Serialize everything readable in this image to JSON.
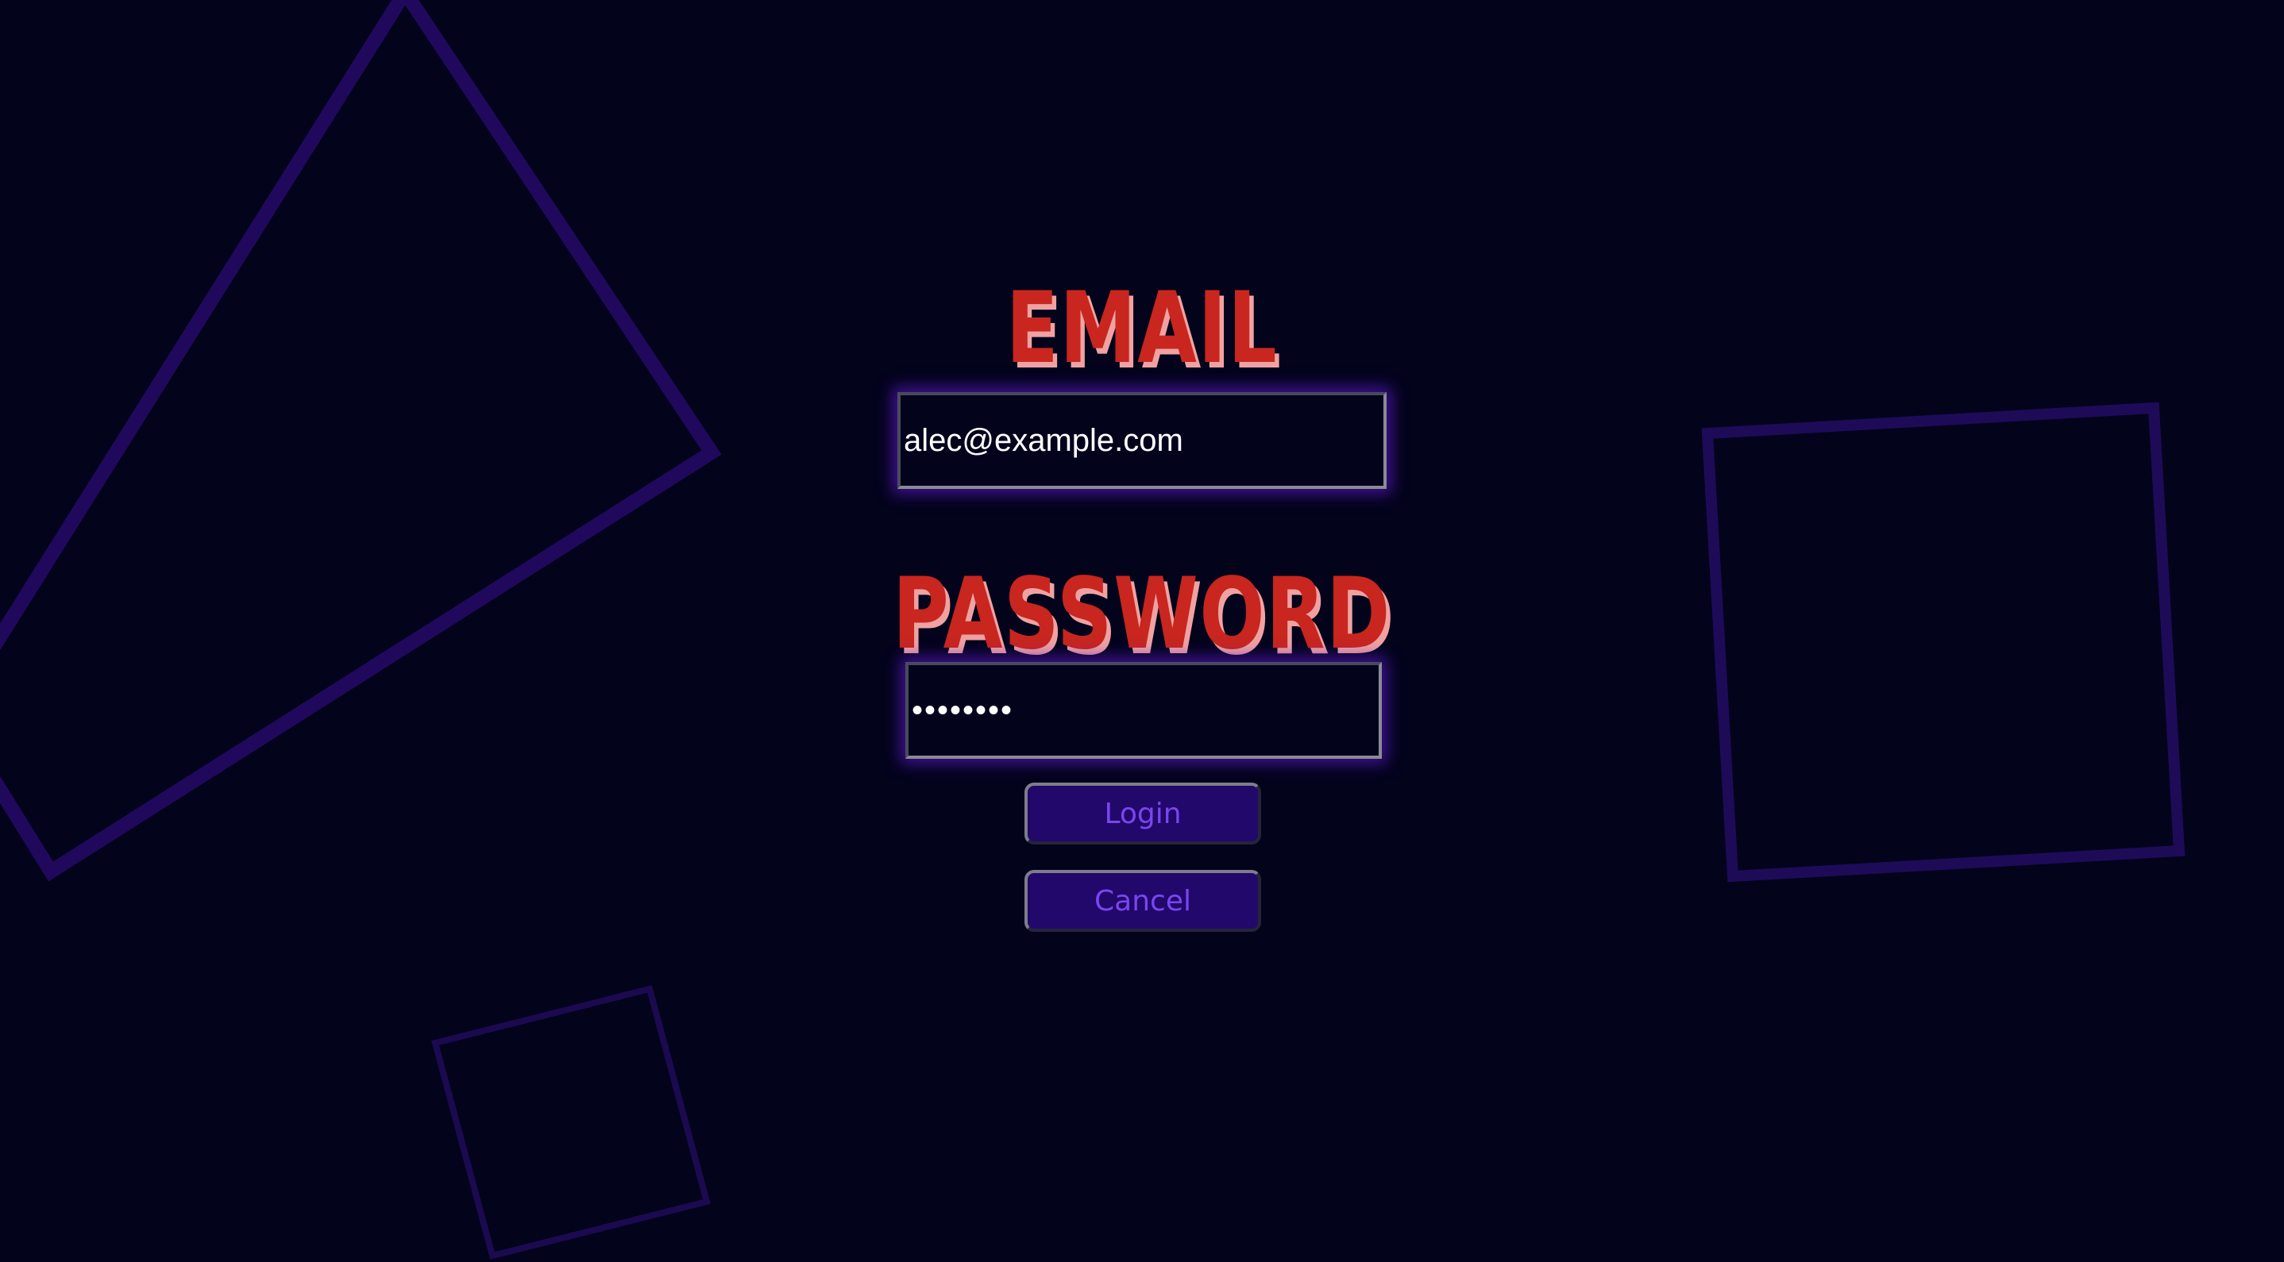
{
  "form": {
    "email_label": "EMAIL",
    "email_value": "alec@example.com",
    "password_label": "PASSWORD",
    "password_value": "••••••••",
    "login_label": "Login",
    "cancel_label": "Cancel"
  },
  "colors": {
    "background": "#03031c",
    "heading": "#c8261f",
    "heading_shadow": "#f0a2a2",
    "button_fill": "#22086a",
    "button_text": "#7a45f0",
    "glow": "#5618be",
    "shape_stroke": "#1f0b5e"
  }
}
